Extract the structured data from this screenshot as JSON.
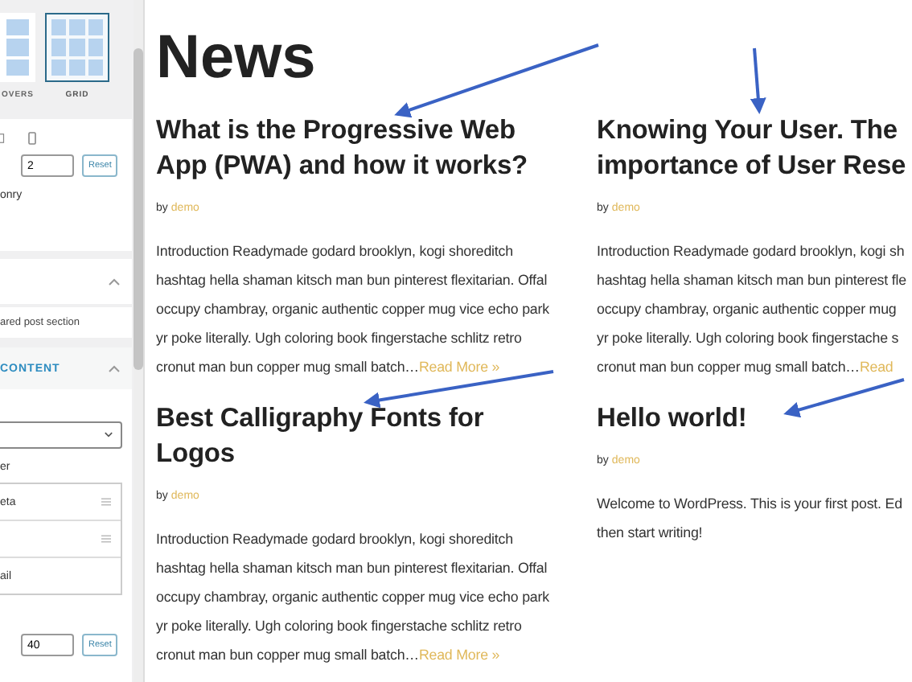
{
  "sidebar": {
    "layouts": [
      {
        "label": "OVERS",
        "selected": false
      },
      {
        "label": "GRID",
        "selected": true
      }
    ],
    "columns": {
      "value": "2",
      "reset": "Reset"
    },
    "style_label": "onry",
    "featured_note": "ared post section",
    "content_section": {
      "title": "CONTENT"
    },
    "order_label": "er",
    "order_items": [
      {
        "label": "eta",
        "handle": true
      },
      {
        "handle": true
      },
      {
        "label": "ail",
        "handle": false
      }
    ],
    "size": {
      "value": "40",
      "reset": "Reset"
    }
  },
  "page": {
    "title": "News",
    "posts": [
      {
        "title": "What is the Progressive Web\nApp (PWA) and how it works?",
        "by": "by",
        "author": "demo",
        "excerpt": "Introduction Readymade godard brooklyn, kogi shoreditch\nhashtag hella shaman kitsch man bun pinterest flexitarian. Offal\noccupy chambray, organic authentic copper mug vice echo park\nyr poke literally. Ugh coloring book fingerstache schlitz retro\ncronut man bun copper mug small batch…",
        "read_more": "Read More »"
      },
      {
        "title": "Knowing Your User. The\nimportance of User Rese",
        "by": "by",
        "author": "demo",
        "excerpt": "Introduction Readymade godard brooklyn, kogi sh\nhashtag hella shaman kitsch man bun pinterest fle\noccupy chambray, organic authentic copper mug\nyr poke literally. Ugh coloring book fingerstache s\ncronut man bun copper mug small batch…",
        "read_more": "Read"
      },
      {
        "title": "Best Calligraphy Fonts for\nLogos",
        "by": "by",
        "author": "demo",
        "excerpt": "Introduction Readymade godard brooklyn, kogi shoreditch\nhashtag hella shaman kitsch man bun pinterest flexitarian. Offal\noccupy chambray, organic authentic copper mug vice echo park\nyr poke literally. Ugh coloring book fingerstache schlitz retro\ncronut man bun copper mug small batch…",
        "read_more": "Read More »"
      },
      {
        "title": "Hello world!",
        "by": "by",
        "author": "demo",
        "excerpt": "Welcome to WordPress. This is your first post. Ed\nthen start writing!"
      }
    ]
  }
}
